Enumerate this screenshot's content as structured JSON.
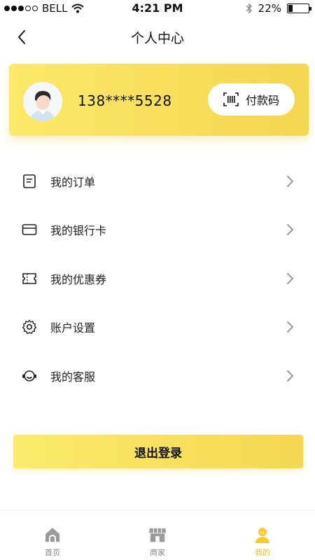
{
  "status_bar": {
    "carrier": "BELL",
    "time": "4:21 PM",
    "battery_percent": "22%",
    "battery_level": 0.22
  },
  "nav": {
    "title": "个人中心"
  },
  "profile": {
    "phone": "138****5528",
    "pay_code_label": "付款码"
  },
  "menu": {
    "items": [
      {
        "label": "我的订单",
        "icon": "order-icon"
      },
      {
        "label": "我的银行卡",
        "icon": "bank-card-icon"
      },
      {
        "label": "我的优惠券",
        "icon": "coupon-icon"
      },
      {
        "label": "账户设置",
        "icon": "gear-icon"
      },
      {
        "label": "我的客服",
        "icon": "customer-service-icon"
      }
    ]
  },
  "logout": {
    "label": "退出登录"
  },
  "tabs": [
    {
      "label": "首页",
      "icon": "home-icon"
    },
    {
      "label": "商家",
      "icon": "shop-icon"
    },
    {
      "label": "我的",
      "icon": "user-icon",
      "active": true
    }
  ],
  "colors": {
    "accent": "#f4d54f",
    "accent_light": "#fbe96a",
    "tab_active": "#f0c020"
  }
}
